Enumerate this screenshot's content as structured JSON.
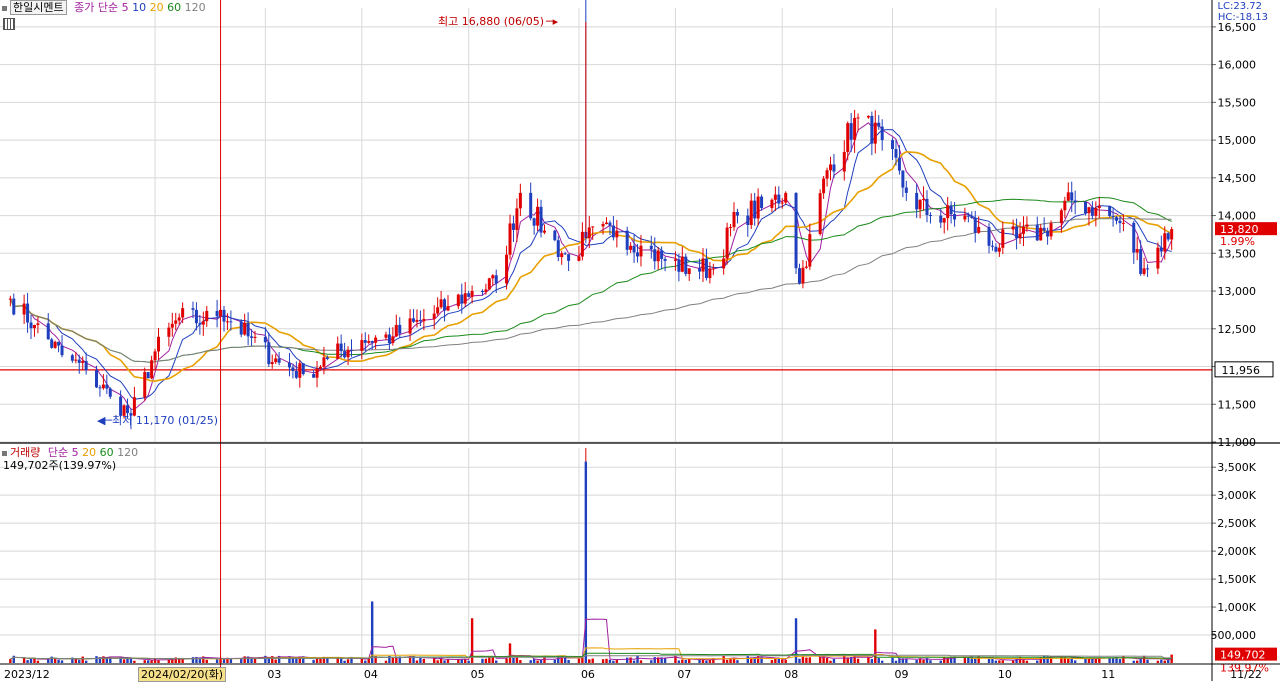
{
  "price_panel": {
    "stock_name": "한일시멘트",
    "indicator_label": "종가 단순",
    "ma_periods": [
      {
        "label": "5",
        "color": "#a020a0"
      },
      {
        "label": "10",
        "color": "#1f3fbf"
      },
      {
        "label": "20",
        "color": "#e8a000"
      },
      {
        "label": "60",
        "color": "#1a8a1a"
      },
      {
        "label": "120",
        "color": "#808080"
      }
    ],
    "lc_label": "LC:23.72",
    "hc_label": "HC:-18.13",
    "high_annotation": "최고 16,880 (06/05)",
    "low_annotation": "최저 11,170 (01/25)",
    "price_tag": "13,820",
    "change_tag": "1.99%",
    "ref_line_tag": "11,956"
  },
  "volume_panel": {
    "indicator_label": "거래량",
    "ma_label": "단순",
    "ma_periods": [
      {
        "label": "5",
        "color": "#a020a0"
      },
      {
        "label": "20",
        "color": "#e8a000"
      },
      {
        "label": "60",
        "color": "#1a8a1a"
      },
      {
        "label": "120",
        "color": "#808080"
      }
    ],
    "last_volume_label": "149,702주(139.97%)",
    "volume_tag": "149,702",
    "volume_pct_tag": "139.97%"
  },
  "x_axis": {
    "month_labels": [
      "2023/12",
      "02",
      "03",
      "04",
      "05",
      "06",
      "07",
      "08",
      "09",
      "10",
      "11"
    ],
    "cursor_date": "2024/02/20(화)",
    "end_label": "11/22"
  },
  "colors": {
    "up": "#e00000",
    "down": "#1f3fbf",
    "cursor": "#e00000",
    "ref_line": "#e00000"
  },
  "chart_data": [
    {
      "type": "candlestick",
      "title": "",
      "ylabel": "",
      "ylim": [
        11000,
        16750
      ],
      "y_ticks": [
        "16,500",
        "16,000",
        "15,500",
        "15,000",
        "14,500",
        "14,000",
        "13,500",
        "13,000",
        "12,500",
        "12,000",
        "11,500",
        "11,000"
      ],
      "grid": true,
      "ohlc_points": [
        {
          "date": "2023-12-21",
          "close": 12900
        },
        {
          "date": "2023-12-28",
          "close": 12550
        },
        {
          "date": "2024-01-05",
          "close": 12150
        },
        {
          "date": "2024-01-12",
          "close": 11950
        },
        {
          "date": "2024-01-19",
          "close": 11600
        },
        {
          "date": "2024-01-25",
          "low": 11170,
          "close": 11350
        },
        {
          "date": "2024-02-01",
          "close": 12200
        },
        {
          "date": "2024-02-08",
          "close": 12650
        },
        {
          "date": "2024-02-15",
          "close": 12600
        },
        {
          "date": "2024-02-20",
          "close": 12750
        },
        {
          "date": "2024-02-28",
          "close": 12400
        },
        {
          "date": "2024-03-08",
          "close": 12050
        },
        {
          "date": "2024-03-15",
          "close": 11900
        },
        {
          "date": "2024-03-22",
          "close": 12100
        },
        {
          "date": "2024-04-01",
          "close": 12350
        },
        {
          "date": "2024-04-10",
          "close": 12400
        },
        {
          "date": "2024-04-18",
          "close": 12600
        },
        {
          "date": "2024-04-26",
          "close": 12800
        },
        {
          "date": "2024-05-03",
          "close": 13000
        },
        {
          "date": "2024-05-10",
          "close": 13100
        },
        {
          "date": "2024-05-17",
          "close": 14300
        },
        {
          "date": "2024-05-24",
          "close": 13800
        },
        {
          "date": "2024-05-31",
          "close": 13400
        },
        {
          "date": "2024-06-05",
          "high": 16880,
          "close": 13700
        },
        {
          "date": "2024-06-14",
          "close": 13800
        },
        {
          "date": "2024-06-21",
          "close": 13600
        },
        {
          "date": "2024-06-28",
          "close": 13400
        },
        {
          "date": "2024-07-05",
          "close": 13300
        },
        {
          "date": "2024-07-12",
          "close": 13300
        },
        {
          "date": "2024-07-19",
          "close": 14000
        },
        {
          "date": "2024-07-26",
          "close": 14100
        },
        {
          "date": "2024-08-02",
          "close": 14300
        },
        {
          "date": "2024-08-06",
          "close": 13100
        },
        {
          "date": "2024-08-14",
          "close": 14600
        },
        {
          "date": "2024-08-23",
          "close": 15300
        },
        {
          "date": "2024-08-30",
          "close": 15000
        },
        {
          "date": "2024-09-06",
          "close": 14300
        },
        {
          "date": "2024-09-13",
          "close": 14000
        },
        {
          "date": "2024-09-23",
          "close": 14000
        },
        {
          "date": "2024-09-30",
          "close": 13600
        },
        {
          "date": "2024-10-08",
          "close": 13700
        },
        {
          "date": "2024-10-16",
          "close": 13800
        },
        {
          "date": "2024-10-24",
          "close": 14200
        },
        {
          "date": "2024-10-31",
          "close": 14100
        },
        {
          "date": "2024-11-07",
          "close": 13900
        },
        {
          "date": "2024-11-14",
          "close": 13300
        },
        {
          "date": "2024-11-22",
          "close": 13820
        }
      ],
      "reference_line": 11956
    },
    {
      "type": "bar",
      "title": "",
      "ylabel": "",
      "ylim": [
        0,
        3700000
      ],
      "y_ticks": [
        "3,500K",
        "3,000K",
        "2,500K",
        "2,000K",
        "1,500K",
        "1,000K",
        "500,000"
      ],
      "spikes": [
        {
          "date": "2024-04-04",
          "value": 1100000
        },
        {
          "date": "2024-05-03",
          "value": 800000
        },
        {
          "date": "2024-05-14",
          "value": 350000
        },
        {
          "date": "2024-06-05",
          "value": 3600000
        },
        {
          "date": "2024-08-05",
          "value": 800000
        },
        {
          "date": "2024-08-28",
          "value": 600000
        }
      ],
      "last_value": 149702
    }
  ]
}
